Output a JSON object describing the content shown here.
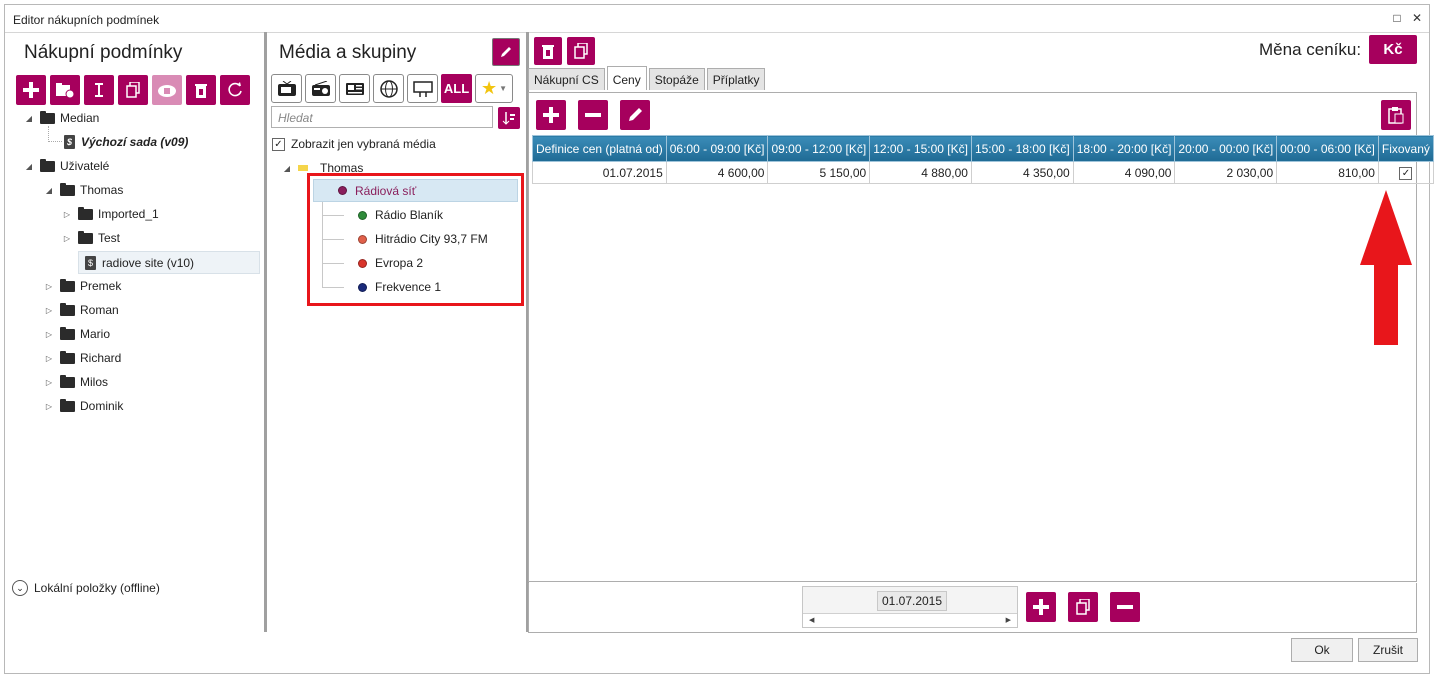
{
  "window": {
    "title": "Editor nákupních podmínek"
  },
  "left_panel": {
    "title": "Nákupní podmínky",
    "toolbar": [
      "add-icon",
      "new-folder-icon",
      "rename-icon",
      "copy-icon",
      "cloud-save-icon",
      "delete-icon",
      "refresh-icon"
    ],
    "tree": {
      "median": "Median",
      "default_set": "Výchozí sada (v09)",
      "users": "Uživatelé",
      "thomas": "Thomas",
      "imported": "Imported_1",
      "test": "Test",
      "radio_sites": "radiove site (v10)",
      "premek": "Premek",
      "roman": "Roman",
      "mario": "Mario",
      "richard": "Richard",
      "milos": "Milos",
      "dominik": "Dominik"
    },
    "offline": "Lokální položky (offline)"
  },
  "middle_panel": {
    "title": "Média a skupiny",
    "media_filters": [
      "tv-icon",
      "radio-icon",
      "press-icon",
      "web-icon",
      "ooh-icon"
    ],
    "all_label": "ALL",
    "search_placeholder": "Hledat",
    "show_selected": "Zobrazit jen vybraná média",
    "tree": {
      "group": "Thomas",
      "network": "Rádiová síť",
      "stations": [
        {
          "name": "Rádio Blaník",
          "color": "#2e8b3a"
        },
        {
          "name": "Hitrádio City 93,7 FM",
          "color": "#e0604a"
        },
        {
          "name": "Evropa 2",
          "color": "#d9342b"
        },
        {
          "name": "Frekvence 1",
          "color": "#1a2a7a"
        }
      ],
      "network_color": "#8a1f5c"
    }
  },
  "right_panel": {
    "currency_label": "Měna ceníku:",
    "currency_value": "Kč",
    "tabs": [
      "Nákupní CS",
      "Ceny",
      "Stopáže",
      "Příplatky"
    ],
    "active_tab": "Ceny",
    "table": {
      "headers": [
        "Definice cen (platná od)",
        "06:00 - 09:00 [Kč]",
        "09:00 - 12:00 [Kč]",
        "12:00 - 15:00 [Kč]",
        "15:00 - 18:00 [Kč]",
        "18:00 - 20:00 [Kč]",
        "20:00 - 00:00 [Kč]",
        "00:00 - 06:00 [Kč]",
        "Fixovaný"
      ],
      "rows": [
        [
          "01.07.2015",
          "4 600,00",
          "5 150,00",
          "4 880,00",
          "4 350,00",
          "4 090,00",
          "2 030,00",
          "810,00",
          true
        ]
      ]
    },
    "date_value": "01.07.2015"
  },
  "footer": {
    "ok": "Ok",
    "cancel": "Zrušit"
  },
  "colors": {
    "accent": "#a6005d",
    "header_blue": "#2e7ca8",
    "highlight_red": "#e8161b"
  }
}
